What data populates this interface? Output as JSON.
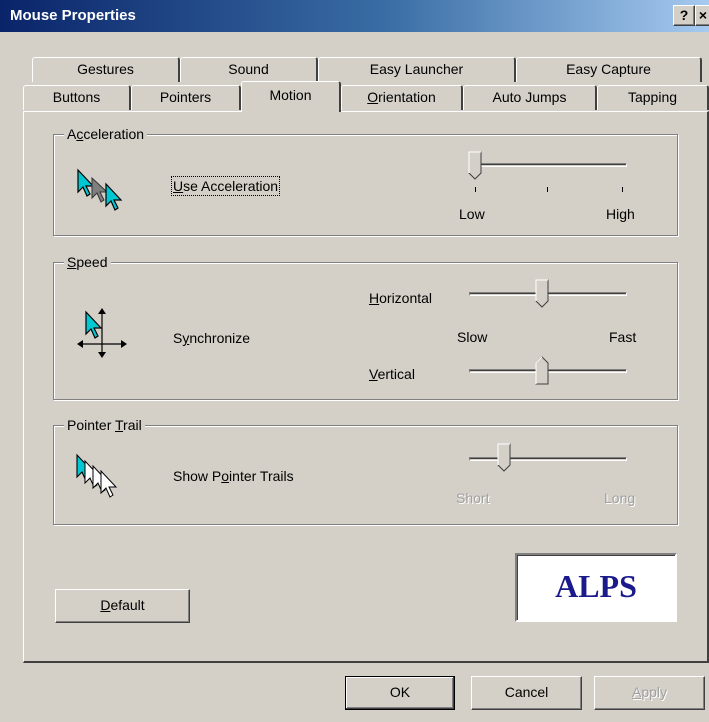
{
  "window": {
    "title": "Mouse Properties",
    "help_label": "?",
    "close_label": "×"
  },
  "tabs": {
    "row1": [
      "Gestures",
      "Sound",
      "Easy Launcher",
      "Easy Capture"
    ],
    "row2": [
      "Buttons",
      "Pointers",
      "Motion",
      "Orientation",
      "Auto Jumps",
      "Tapping"
    ],
    "active": "Motion"
  },
  "acceleration": {
    "legend": "Acceleration",
    "checkbox_label": "Use Acceleration",
    "checked": true,
    "slider_low": "Low",
    "slider_high": "High",
    "slider_level": 0
  },
  "speed": {
    "legend": "Speed",
    "checkbox_label": "Synchronize",
    "checked": true,
    "horizontal_label": "Horizontal",
    "vertical_label": "Vertical",
    "slow_label": "Slow",
    "fast_label": "Fast",
    "horizontal_level": 0.5,
    "vertical_level": 0.5
  },
  "pointer_trail": {
    "legend": "Pointer Trail",
    "checkbox_label": "Show Pointer Trails",
    "checked": false,
    "short_label": "Short",
    "long_label": "Long",
    "level": 0.25,
    "enabled": false
  },
  "buttons": {
    "default": "Default",
    "ok": "OK",
    "cancel": "Cancel",
    "apply": "Apply"
  },
  "logo": {
    "text": "ALPS"
  },
  "colors": {
    "titlebar_start": "#0a246a",
    "titlebar_end": "#a6caf0",
    "face": "#d4d0c8",
    "logo_text": "#1a1a8c",
    "pointer_cyan": "#00c8d2"
  }
}
